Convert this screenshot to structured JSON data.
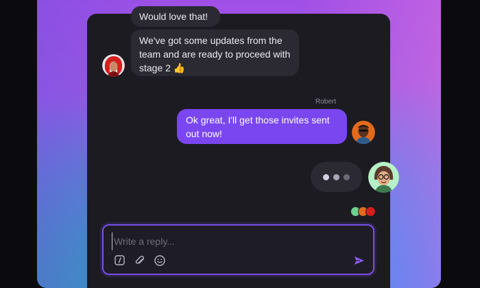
{
  "messages": [
    {
      "text": "Would love that!"
    },
    {
      "text": "We've got some updates from the team and are ready to proceed with stage 2 👍"
    },
    {
      "sender": "Robert",
      "text": "Ok great, I'll get those invites sent out now!"
    }
  ],
  "composer": {
    "placeholder": "Write a reply..."
  },
  "colors": {
    "panel": "#1c1b22",
    "incoming_bubble": "#2b2a33",
    "outgoing_bubble": "#7a46f0",
    "accent": "#8b5cf6"
  },
  "icons": [
    "slash-command-icon",
    "attachment-icon",
    "emoji-icon",
    "send-icon"
  ]
}
